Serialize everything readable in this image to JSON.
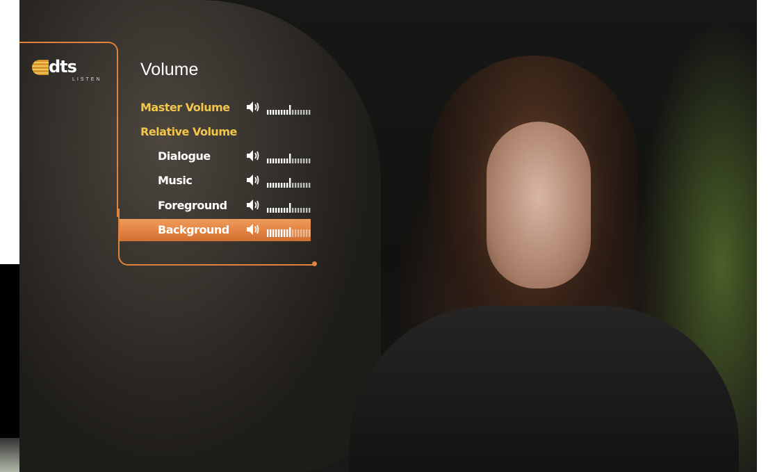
{
  "menu": {
    "title": "Volume",
    "logo": {
      "text": "dts",
      "subtitle": "LISTEN"
    },
    "accent_color": "#e0833b",
    "label_highlight_color": "#f3c64a",
    "items": [
      {
        "label": "Master Volume",
        "level": 0.55,
        "style": "header",
        "indent": false,
        "selected": false
      },
      {
        "label": "Relative Volume",
        "level": null,
        "style": "header",
        "indent": false,
        "selected": false
      },
      {
        "label": "Dialogue",
        "level": 0.55,
        "style": "item",
        "indent": true,
        "selected": false
      },
      {
        "label": "Music",
        "level": 0.55,
        "style": "item",
        "indent": true,
        "selected": false
      },
      {
        "label": "Foreground",
        "level": 0.55,
        "style": "item",
        "indent": true,
        "selected": false
      },
      {
        "label": "Background",
        "level": 0.55,
        "style": "item",
        "indent": true,
        "selected": true
      }
    ]
  }
}
